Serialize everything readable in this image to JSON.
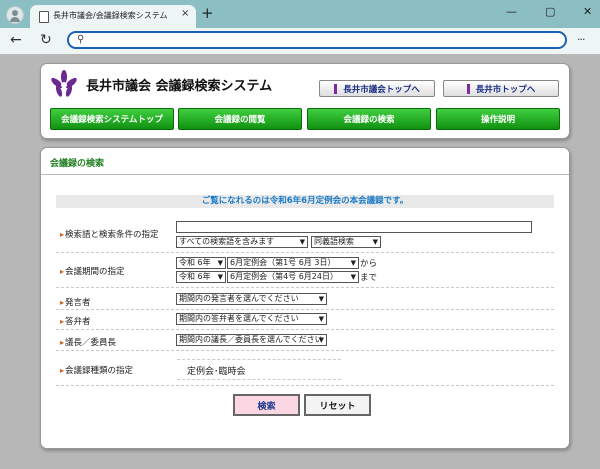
{
  "browser": {
    "tab_title": "長井市議会/会議録検索システム",
    "tab_close": "×",
    "new_tab": "+",
    "back": "←",
    "reload": "↻",
    "search_glyph": "⚲",
    "menu": "···",
    "minimize": "—",
    "maximize": "▢",
    "close": "✕",
    "address_value": "",
    "icons": [
      "profile-avatar-icon",
      "page-icon",
      "search-icon"
    ]
  },
  "header": {
    "site_title": "長井市議会 会議録検索システム",
    "links": [
      "長井市議会トップへ",
      "長井市トップへ"
    ],
    "nav": [
      "会議録検索システムトップ",
      "会議録の閲覧",
      "会議録の検索",
      "操作説明"
    ]
  },
  "search": {
    "section_title": "会議録の検索",
    "notice": "ご覧になれるのは令和6年6月定例会の本会議録です。",
    "keyword": {
      "label": "検索語と検索条件の指定",
      "value": "",
      "condition": "すべての検索語を含みます",
      "synonym": "同義語検索"
    },
    "period": {
      "label": "会議期間の指定",
      "from_year": "令和 6年",
      "from_session": "6月定例会（第1号 6月 3日）",
      "from_suffix": "から",
      "to_year": "令和 6年",
      "to_session": "6月定例会（第4号 6月24日）",
      "to_suffix": "まで"
    },
    "speaker": {
      "label": "発言者",
      "value": "期間内の発言者を選んでください"
    },
    "responder": {
      "label": "答弁者",
      "value": "期間内の答弁者を選んでください"
    },
    "chair": {
      "label": "議長／委員長",
      "value": "期間内の議長／委員長を選んでください"
    },
    "kind": {
      "label": "会議録種類の指定",
      "value": "定例会･臨時会"
    },
    "buttons": {
      "search": "検索",
      "reset": "リセット"
    }
  },
  "colors": {
    "accent_green": "#1f7e1f",
    "notice_blue": "#1a7ac6",
    "label_bullet": "#d1601a",
    "search_button_bg": "#fbd6e3"
  }
}
